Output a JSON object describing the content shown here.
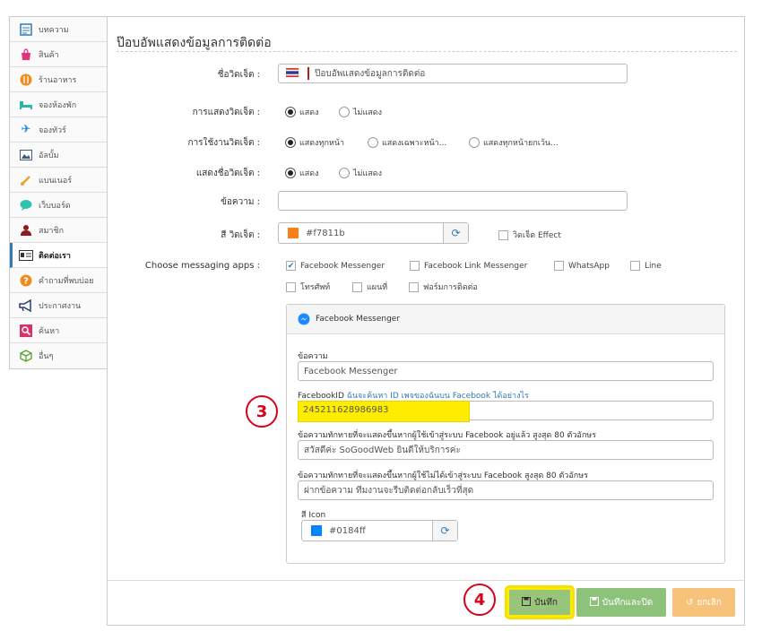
{
  "sidebar": {
    "items": [
      {
        "label": "บทความ",
        "icon": "article-icon"
      },
      {
        "label": "สินค้า",
        "icon": "shopping-bag-icon"
      },
      {
        "label": "ร้านอาหาร",
        "icon": "restaurant-icon"
      },
      {
        "label": "จองห้องพัก",
        "icon": "bed-icon"
      },
      {
        "label": "จองทัวร์",
        "icon": "plane-icon"
      },
      {
        "label": "อัลบั้ม",
        "icon": "image-icon"
      },
      {
        "label": "แบนเนอร์",
        "icon": "brush-icon"
      },
      {
        "label": "เว็บบอร์ด",
        "icon": "chat-bubble-icon"
      },
      {
        "label": "สมาชิก",
        "icon": "user-icon"
      },
      {
        "label": "ติดต่อเรา",
        "icon": "contact-card-icon"
      },
      {
        "label": "คำถามที่พบบ่อย",
        "icon": "question-icon"
      },
      {
        "label": "ประกาศงาน",
        "icon": "megaphone-icon"
      },
      {
        "label": "ค้นหา",
        "icon": "search-icon"
      },
      {
        "label": "อื่นๆ",
        "icon": "cube-icon"
      }
    ],
    "active_index": 9
  },
  "form": {
    "title": "ป๊อบอัพแสดงข้อมูลการติดต่อ",
    "widget_name": {
      "label": "ชื่อวิดเจ็ต :",
      "value": "ป๊อบอัพแสดงข้อมูลการติดต่อ"
    },
    "display_widget": {
      "label": "การแสดงวิดเจ็ต :",
      "options": [
        "แสดง",
        "ไม่แสดง"
      ],
      "selected": 0
    },
    "usage": {
      "label": "การใช้งานวิดเจ็ต :",
      "options": [
        "แสดงทุกหน้า",
        "แสดงเฉพาะหน้า...",
        "แสดงทุกหน้ายกเว้น..."
      ],
      "selected": 0
    },
    "show_name": {
      "label": "แสดงชื่อวิดเจ็ต :",
      "options": [
        "แสดง",
        "ไม่แสดง"
      ],
      "selected": 0
    },
    "message": {
      "label": "ข้อความ :",
      "value": ""
    },
    "widget_color": {
      "label": "สี วิดเจ็ต :",
      "value": "#f7811b",
      "effect_label": "วิดเจ็ต Effect"
    },
    "apps": {
      "label": "Choose messaging apps :",
      "options": [
        {
          "label": "Facebook Messenger",
          "checked": true
        },
        {
          "label": "Facebook Link Messenger",
          "checked": false
        },
        {
          "label": "WhatsApp",
          "checked": false
        },
        {
          "label": "Line",
          "checked": false
        },
        {
          "label": "โทรศัพท์",
          "checked": false
        },
        {
          "label": "แผนที่",
          "checked": false
        },
        {
          "label": "ฟอร์มการติดต่อ",
          "checked": false
        }
      ]
    }
  },
  "messenger": {
    "title": "Facebook Messenger",
    "message_label": "ข้อความ",
    "message_value": "Facebook Messenger",
    "fbid_label": "FacebookID",
    "fbid_link": "ฉันจะค้นหา ID เพจของฉันบน Facebook ได้อย่างไร",
    "fbid_value": "245211628986983",
    "greet_login_label": "ข้อความทักทายที่จะแสดงขึ้นหากผู้ใช้เข้าสู่ระบบ Facebook อยู่แล้ว สูงสุด 80 ตัวอักษร",
    "greet_login_value": "สวัสดีค่ะ SoGoodWeb ยินดีให้บริการค่ะ",
    "greet_logout_label": "ข้อความทักทายที่จะแสดงขึ้นหากผู้ใช้ไม่ได้เข้าสู่ระบบ Facebook สูงสุด 80 ตัวอักษร",
    "greet_logout_value": "ฝากข้อความ ทีมงานจะรีบติดต่อกลับเร็วที่สุด",
    "icon_color_label": "สี Icon",
    "icon_color_value": "#0184ff"
  },
  "annotations": {
    "step3": "3",
    "step4": "4"
  },
  "buttons": {
    "save": "บันทึก",
    "save_close": "บันทึกและปิด",
    "cancel": "ยกเลิก"
  },
  "colors": {
    "widget": "#f7811b",
    "icon": "#0184ff",
    "messenger_blue": "#1a8cff",
    "annotation_red": "#d9001b",
    "highlight_yellow": "#ffed00"
  }
}
